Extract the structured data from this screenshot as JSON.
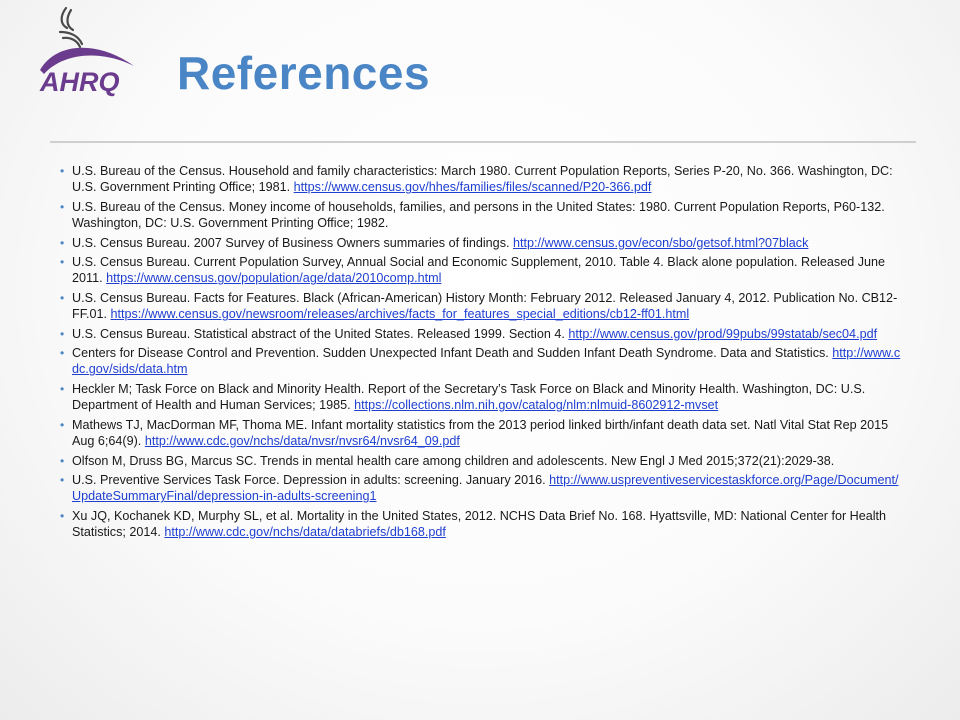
{
  "header": {
    "logo_icon": "hhs-ahrq-logo-icon",
    "logo_text": "AHRQ",
    "title": "References"
  },
  "colors": {
    "title": "#4a86c5",
    "bullet": "#4a86c5",
    "link": "#1f3fd1",
    "logo_purple": "#6b3c8e",
    "text": "#1a1a1a",
    "divider": "#cfcfcf"
  },
  "references": [
    {
      "text": "U.S. Bureau of the Census. Household and family characteristics: March 1980. Current Population Reports, Series P-20, No. 366. Washington, DC: U.S. Government Printing Office; 1981. ",
      "link": "https://www.census.gov/hhes/families/files/scanned/P20-366.pdf"
    },
    {
      "text": "U.S. Bureau of the Census. Money income of households, families, and persons in the United States: 1980. Current Population Reports, P60-132. Washington, DC: U.S. Government Printing Office; 1982.",
      "link": ""
    },
    {
      "text": "U.S. Census Bureau. 2007 Survey of Business Owners summaries of findings. ",
      "link": "http://www.census.gov/econ/sbo/getsof.html?07black"
    },
    {
      "text": "U.S. Census Bureau. Current Population Survey, Annual Social and Economic Supplement, 2010. Table 4. Black alone population. Released June 2011. ",
      "link": "https://www.census.gov/population/age/data/2010comp.html"
    },
    {
      "text": "U.S. Census Bureau. Facts for Features. Black (African-American) History Month: February 2012. Released January 4, 2012. Publication No. CB12-FF.01. ",
      "link": "https://www.census.gov/newsroom/releases/archives/facts_for_features_special_editions/cb12-ff01.html"
    },
    {
      "text": "U.S. Census Bureau. Statistical abstract of the United States. Released 1999. Section 4. ",
      "link": "http://www.census.gov/prod/99pubs/99statab/sec04.pdf"
    },
    {
      "text": "Centers for Disease Control and Prevention. Sudden Unexpected Infant Death and Sudden Infant Death Syndrome. Data and Statistics. ",
      "link": "http://www.cdc.gov/sids/data.htm"
    },
    {
      "text": "Heckler M; Task Force on Black and Minority Health. Report of the Secretary’s Task Force on Black and Minority Health. Washington, DC: U.S. Department of Health and Human Services; 1985. ",
      "link": "https://collections.nlm.nih.gov/catalog/nlm:nlmuid-8602912-mvset"
    },
    {
      "text": "Mathews TJ, MacDorman MF, Thoma ME. Infant mortality statistics from the 2013 period linked birth/infant death data set. Natl Vital Stat Rep 2015 Aug 6;64(9). ",
      "link": "http://www.cdc.gov/nchs/data/nvsr/nvsr64/nvsr64_09.pdf"
    },
    {
      "text": "Olfson M, Druss BG, Marcus SC. Trends in mental health care among children and adolescents. New Engl J Med 2015;372(21):2029-38.",
      "link": ""
    },
    {
      "text": "U.S. Preventive Services Task Force. Depression in adults: screening. January 2016. ",
      "link": "http://www.uspreventiveservicestaskforce.org/Page/Document/UpdateSummaryFinal/depression-in-adults-screening1"
    },
    {
      "text": "Xu JQ, Kochanek KD, Murphy SL, et al. Mortality in the United States, 2012. NCHS Data Brief No. 168. Hyattsville, MD: National Center for Health Statistics; 2014. ",
      "link": "http://www.cdc.gov/nchs/data/databriefs/db168.pdf"
    }
  ]
}
